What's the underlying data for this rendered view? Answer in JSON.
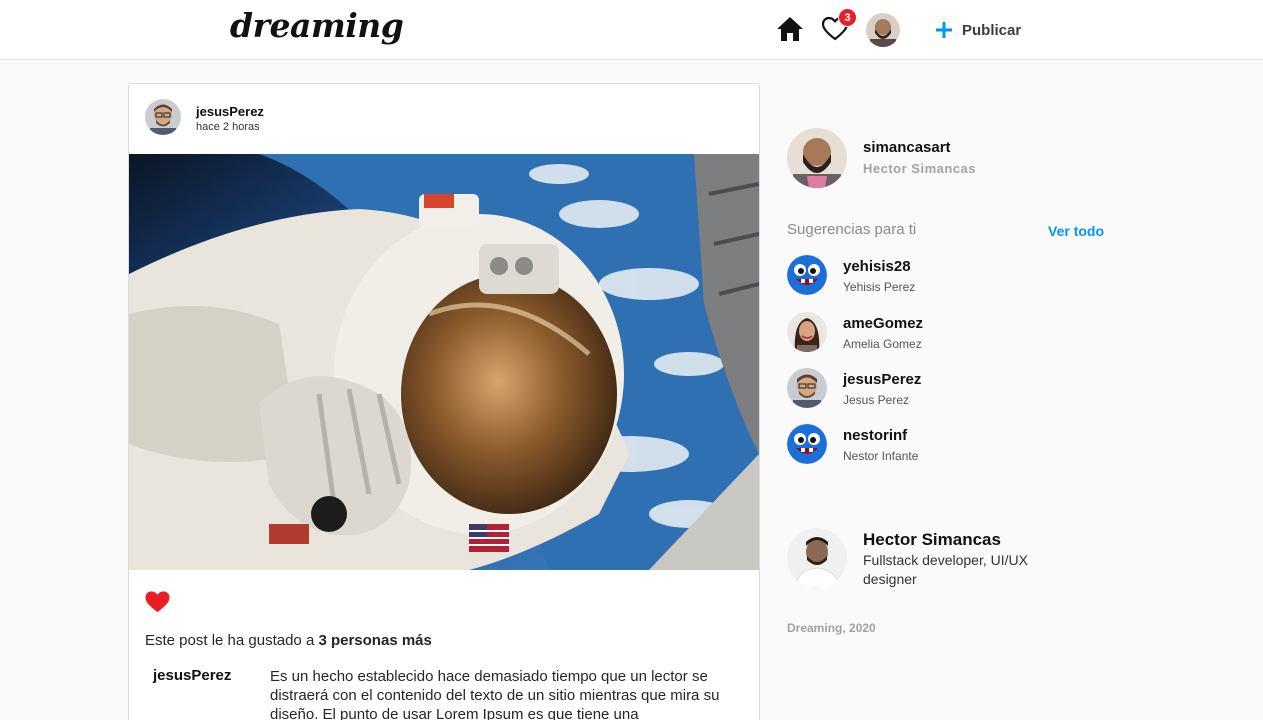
{
  "header": {
    "logo": "dreaming",
    "home_icon": "home-icon",
    "likes_icon": "heart-outline-icon",
    "notification_count": "3",
    "publish_label": "Publicar",
    "accent_color": "#0095f6",
    "badge_color": "#e5202b"
  },
  "post": {
    "username": "jesusPerez",
    "time": "hace 2 horas",
    "image_alt": "Astronaut on a spacewalk above Earth",
    "liked": true,
    "likes_prefix": "Este post le ha gustado a ",
    "likes_bold": "3 personas más",
    "caption_user": "jesusPerez",
    "caption": "Es un hecho establecido hace demasiado tiempo que un lector se distraerá con el contenido del texto de un sitio mientras que mira su diseño. El punto de usar Lorem Ipsum es que tiene una"
  },
  "sidebar": {
    "me": {
      "username": "simancasart",
      "name": "Hector Simancas"
    },
    "suggestions_title": "Sugerencias para ti",
    "see_all": "Ver todo",
    "suggestions": [
      {
        "username": "yehisis28",
        "name": "Yehisis Perez",
        "avatar": "monster"
      },
      {
        "username": "ameGomez",
        "name": "Amelia Gomez",
        "avatar": "woman"
      },
      {
        "username": "jesusPerez",
        "name": "Jesus Perez",
        "avatar": "man-glasses"
      },
      {
        "username": "nestorinf",
        "name": "Nestor Infante",
        "avatar": "monster"
      }
    ],
    "developer": {
      "name": "Hector Simancas",
      "role": "Fullstack developer, UI/UX designer"
    },
    "footer": "Dreaming, 2020"
  }
}
